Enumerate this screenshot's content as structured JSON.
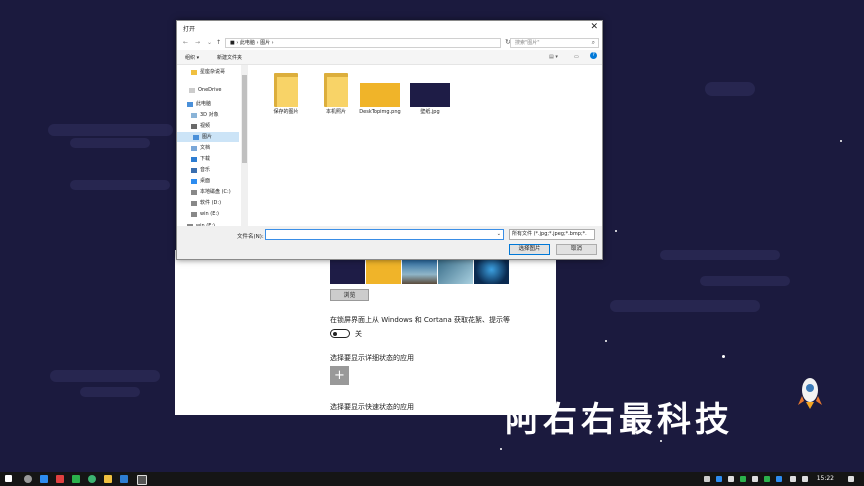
{
  "dialog": {
    "title": "打开",
    "close": "✕",
    "address": "■ ›  此电脑  ›  图片  ›",
    "search_placeholder": "搜索\"图片\"",
    "toolbar": {
      "organize": "组织 ▾",
      "new_folder": "新建文件夹"
    },
    "nav_items": [
      {
        "label": "星座杂说哥",
        "icon": "folder-icon"
      },
      {
        "label": "OneDrive",
        "icon": "onedrive-icon"
      },
      {
        "label": "此电脑",
        "icon": "pc-icon"
      },
      {
        "label": "3D 对象",
        "icon": "3d-icon"
      },
      {
        "label": "视频",
        "icon": "video-icon"
      },
      {
        "label": "图片",
        "icon": "pictures-icon",
        "selected": true
      },
      {
        "label": "文档",
        "icon": "documents-icon"
      },
      {
        "label": "下载",
        "icon": "download-icon"
      },
      {
        "label": "音乐",
        "icon": "music-icon"
      },
      {
        "label": "桌面",
        "icon": "desktop-icon"
      },
      {
        "label": "本地磁盘 (C:)",
        "icon": "drive-icon"
      },
      {
        "label": "软件 (D:)",
        "icon": "drive-icon"
      },
      {
        "label": "win (E:)",
        "icon": "drive-icon"
      },
      {
        "label": "win (E:)",
        "icon": "drive-icon"
      }
    ],
    "files": [
      {
        "name": "保存的图片",
        "type": "folder"
      },
      {
        "name": "本机照片",
        "type": "folder"
      },
      {
        "name": "DeskTopimg.png",
        "type": "image",
        "color": "#f0b429"
      },
      {
        "name": "壁纸.jpg",
        "type": "image",
        "color": "#1e1c46"
      }
    ],
    "filename_label": "文件名(N):",
    "filename_value": "",
    "filter": "所有文件 (*.jpg;*.jpeg;*.bmp;*.",
    "open_button": "选择图片",
    "cancel_button": "取消"
  },
  "settings": {
    "browse_button": "浏览",
    "lockscreen_text": "在锁屏界面上从 Windows 和 Cortana 获取花絮、提示等",
    "toggle_label": "关",
    "detail_status_heading": "选择要显示详细状态的应用",
    "add_app": "+",
    "quick_status_heading": "选择要显示快速状态的应用"
  },
  "watermark": {
    "text": "阿右右最科技"
  },
  "taskbar": {
    "time": "15:22"
  },
  "colors": {
    "background": "#1b1a3e",
    "accent": "#0078d7",
    "folder": "#f8d367"
  }
}
